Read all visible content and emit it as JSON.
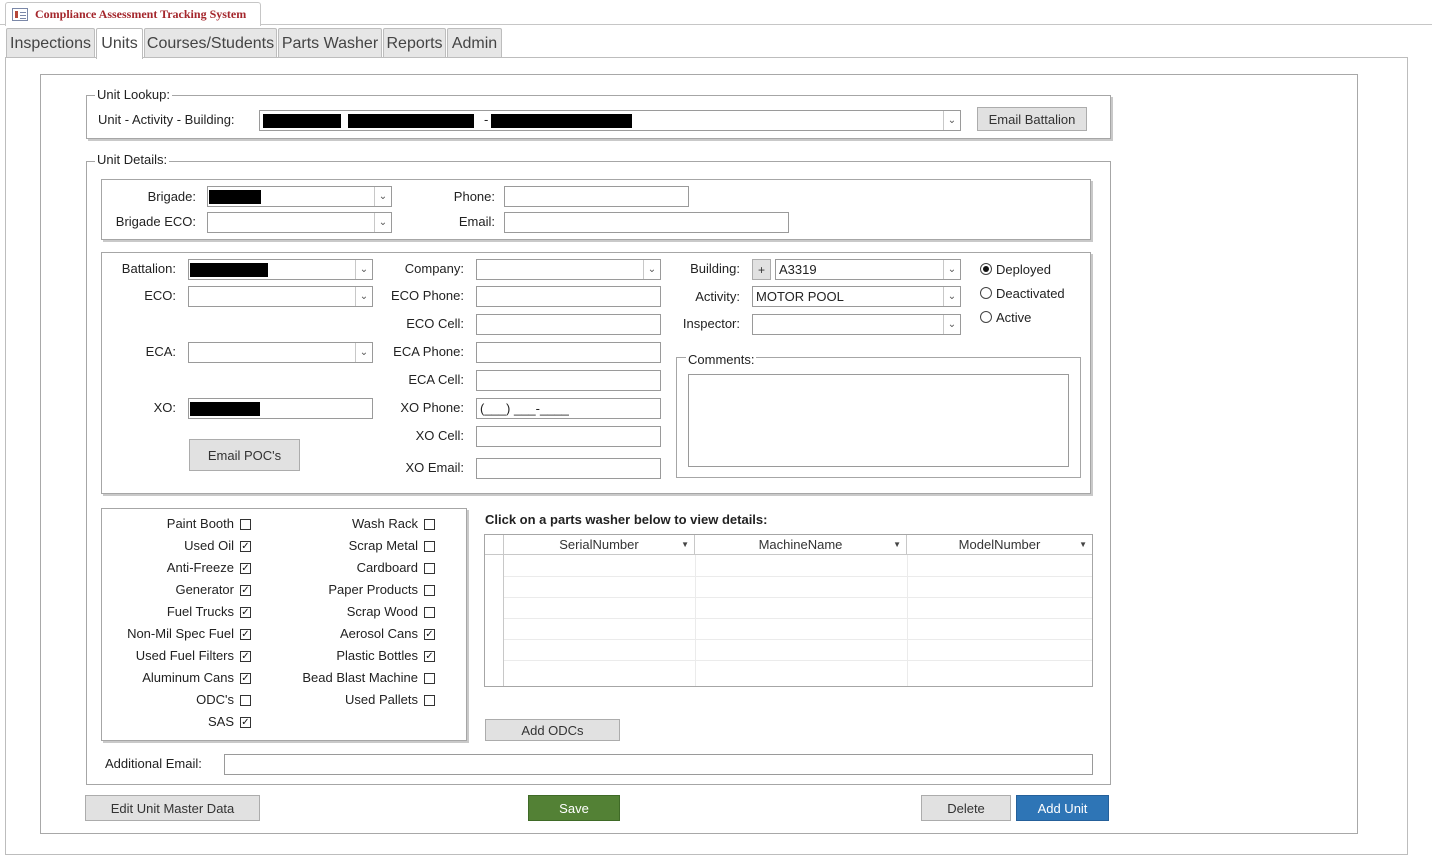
{
  "app": {
    "title": "Compliance Assessment Tracking System"
  },
  "tabs": [
    "Inspections",
    "Units",
    "Courses/Students",
    "Parts Washer",
    "Reports",
    "Admin"
  ],
  "unit_lookup": {
    "legend": "Unit Lookup:",
    "label": "Unit - Activity - Building:",
    "separator": "-",
    "email_battalion_label": "Email Battalion"
  },
  "unit_details": {
    "legend": "Unit Details:"
  },
  "brigade": {
    "brigade_label": "Brigade:",
    "brigade_eco_label": "Brigade ECO:",
    "phone_label": "Phone:",
    "email_label": "Email:"
  },
  "battalion": {
    "battalion_label": "Battalion:",
    "eco_label": "ECO:",
    "eca_label": "ECA:",
    "xo_label": "XO:",
    "email_pocs_label": "Email POC's",
    "company_label": "Company:",
    "eco_phone_label": "ECO Phone:",
    "eco_cell_label": "ECO Cell:",
    "eca_phone_label": "ECA Phone:",
    "eca_cell_label": "ECA Cell:",
    "xo_phone_label": "XO Phone:",
    "xo_phone_value": "(___) ___-____",
    "xo_cell_label": "XO Cell:",
    "xo_email_label": "XO Email:",
    "building_label": "Building:",
    "building_plus": "+",
    "building_value": "A3319",
    "activity_label": "Activity:",
    "activity_value": "MOTOR POOL",
    "inspector_label": "Inspector:",
    "comments_legend": "Comments:"
  },
  "status_options": [
    {
      "label": "Deployed",
      "selected": true
    },
    {
      "label": "Deactivated",
      "selected": false
    },
    {
      "label": "Active",
      "selected": false
    }
  ],
  "checklist_left": [
    {
      "label": "Paint Booth",
      "checked": false
    },
    {
      "label": "Used Oil",
      "checked": true
    },
    {
      "label": "Anti-Freeze",
      "checked": true
    },
    {
      "label": "Generator",
      "checked": true
    },
    {
      "label": "Fuel Trucks",
      "checked": true
    },
    {
      "label": "Non-Mil Spec Fuel",
      "checked": true
    },
    {
      "label": "Used Fuel Filters",
      "checked": true
    },
    {
      "label": "Aluminum Cans",
      "checked": true
    },
    {
      "label": "ODC's",
      "checked": false
    },
    {
      "label": "SAS",
      "checked": true
    }
  ],
  "checklist_right": [
    {
      "label": "Wash Rack",
      "checked": false
    },
    {
      "label": "Scrap Metal",
      "checked": false
    },
    {
      "label": "Cardboard",
      "checked": false
    },
    {
      "label": "Paper Products",
      "checked": false
    },
    {
      "label": "Scrap Wood",
      "checked": false
    },
    {
      "label": "Aerosol Cans",
      "checked": true
    },
    {
      "label": "Plastic Bottles",
      "checked": true
    },
    {
      "label": "Bead Blast Machine",
      "checked": false
    },
    {
      "label": "Used Pallets",
      "checked": false
    }
  ],
  "parts_washer": {
    "heading": "Click on a parts washer below to view details:",
    "columns": [
      "SerialNumber",
      "MachineName",
      "ModelNumber"
    ],
    "add_odcs_label": "Add ODCs"
  },
  "additional_email": {
    "label": "Additional Email:"
  },
  "footer": {
    "edit_master_label": "Edit Unit Master Data",
    "save_label": "Save",
    "delete_label": "Delete",
    "add_unit_label": "Add Unit"
  },
  "colors": {
    "title_text": "#a4262c",
    "save_button": "#538135",
    "add_button": "#2e75b6"
  },
  "icons": {
    "form_icon": "form-icon",
    "combo_arrow": "chevron-down-icon",
    "sort_arrow": "sort-arrow-icon"
  }
}
